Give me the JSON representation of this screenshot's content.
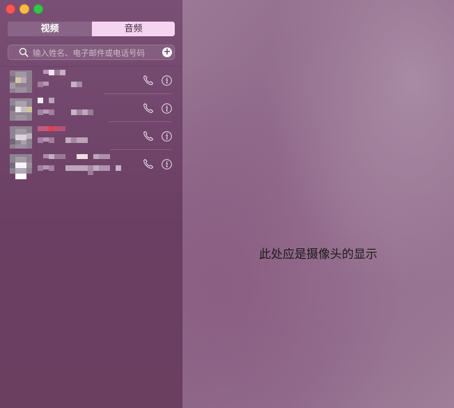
{
  "window": {
    "controls": [
      "close",
      "minimize",
      "maximize"
    ]
  },
  "segmented": {
    "video_label": "视频",
    "audio_label": "音频",
    "selected": "video"
  },
  "search": {
    "placeholder": "输入姓名、电子邮件或电话号码",
    "value": ""
  },
  "contacts": [
    {
      "name": "[redacted]",
      "detail": "[redacted]"
    },
    {
      "name": "[redacted]",
      "detail": "[redacted]"
    },
    {
      "name": "[redacted]",
      "detail": "[redacted]"
    },
    {
      "name": "[redacted]",
      "detail": "[redacted]"
    }
  ],
  "camera": {
    "placeholder_text": "此处应是摄像头的显示"
  },
  "colors": {
    "sidebar": "#6d4567",
    "segment_selected": "#8a6486",
    "segment_unselected": "#f5d4f1",
    "close": "#fc5753",
    "minimize": "#fdbc40",
    "maximize": "#33c748"
  },
  "icons": [
    "search-icon",
    "add-contact-icon",
    "phone-icon",
    "info-icon"
  ]
}
